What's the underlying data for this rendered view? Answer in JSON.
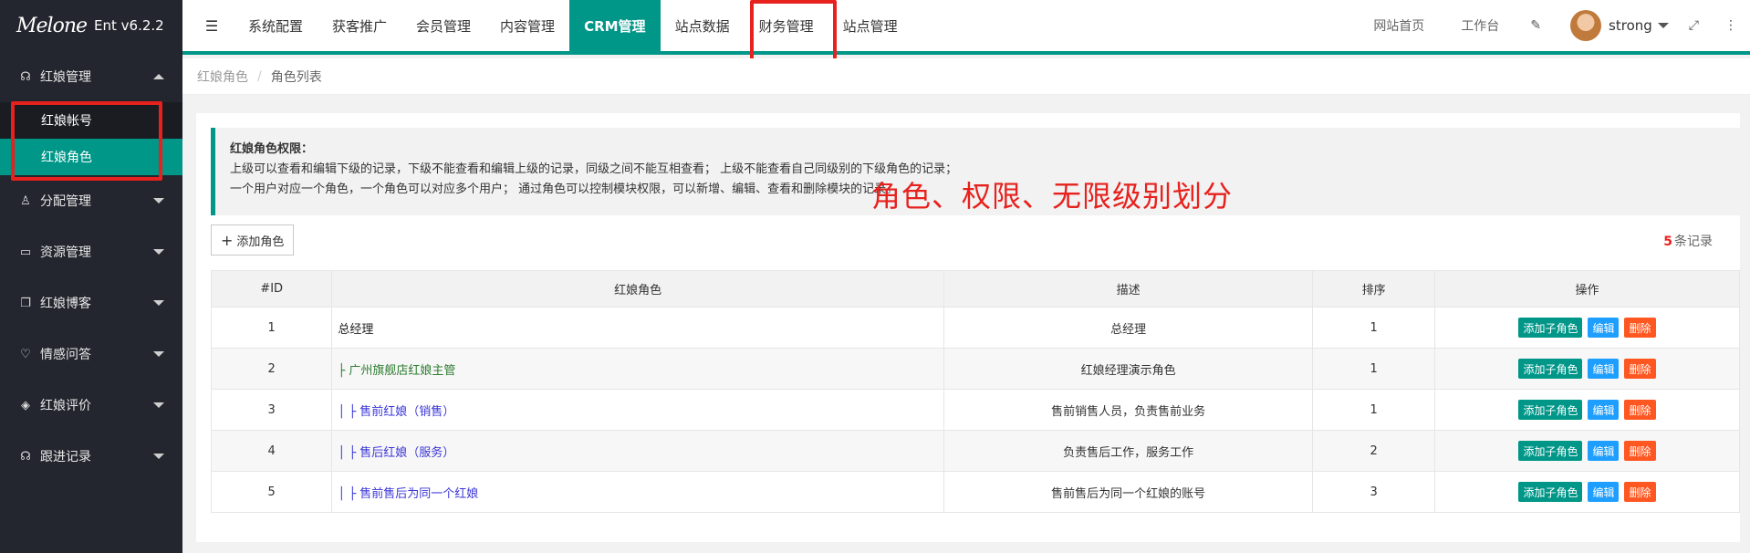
{
  "brand": {
    "logo_text": "Melone",
    "version": "Ent v6.2.2"
  },
  "sidebar": {
    "groups": [
      {
        "label": "红娘管理",
        "icon": "headset-icon",
        "expanded": true,
        "items": [
          {
            "label": "红娘帐号",
            "active": false
          },
          {
            "label": "红娘角色",
            "active": true
          }
        ]
      },
      {
        "label": "分配管理",
        "icon": "user-assign-icon",
        "expanded": false
      },
      {
        "label": "资源管理",
        "icon": "folder-icon",
        "expanded": false
      },
      {
        "label": "红娘博客",
        "icon": "blog-icon",
        "expanded": false
      },
      {
        "label": "情感问答",
        "icon": "heart-pulse-icon",
        "expanded": false
      },
      {
        "label": "红娘评价",
        "icon": "review-icon",
        "expanded": false
      },
      {
        "label": "跟进记录",
        "icon": "headset-icon",
        "expanded": false
      }
    ]
  },
  "header": {
    "tabs": [
      {
        "label": "系统配置",
        "active": false
      },
      {
        "label": "获客推广",
        "active": false
      },
      {
        "label": "会员管理",
        "active": false
      },
      {
        "label": "内容管理",
        "active": false
      },
      {
        "label": "CRM管理",
        "active": true
      },
      {
        "label": "站点数据",
        "active": false
      },
      {
        "label": "财务管理",
        "active": false
      },
      {
        "label": "站点管理",
        "active": false
      }
    ],
    "links": {
      "site_home": "网站首页",
      "workbench": "工作台"
    },
    "user_name": "strong"
  },
  "breadcrumb": {
    "parent": "红娘角色",
    "separator": "/",
    "current": "角色列表"
  },
  "note": {
    "title": "红娘角色权限：",
    "line1": "上级可以查看和编辑下级的记录，下级不能查看和编辑上级的记录，同级之间不能互相查看； 上级不能查看自己同级别的下级角色的记录；",
    "line2": "一个用户对应一个角色，一个角色可以对应多个用户； 通过角色可以控制模块权限，可以新增、编辑、查看和删除模块的记录。"
  },
  "annotation": "角色、权限、无限级别划分",
  "toolbar": {
    "add_label": "添加角色",
    "count": "5",
    "count_suffix": "条记录"
  },
  "table": {
    "headers": [
      "#ID",
      "红娘角色",
      "描述",
      "排序",
      "操作"
    ],
    "rows": [
      {
        "id": "1",
        "role": "总经理",
        "level": 0,
        "desc": "总经理",
        "sort": "1"
      },
      {
        "id": "2",
        "role": "├ 广州旗舰店红娘主管",
        "level": 1,
        "desc": "红娘经理演示角色",
        "sort": "1"
      },
      {
        "id": "3",
        "role": "│  ├ 售前红娘（销售）",
        "level": 2,
        "desc": "售前销售人员，负责售前业务",
        "sort": "1"
      },
      {
        "id": "4",
        "role": "│  ├ 售后红娘（服务）",
        "level": 2,
        "desc": "负责售后工作，服务工作",
        "sort": "2"
      },
      {
        "id": "5",
        "role": "│  ├ 售前售后为同一个红娘",
        "level": 2,
        "desc": "售前售后为同一个红娘的账号",
        "sort": "3"
      }
    ],
    "ops": {
      "add_child": "添加子角色",
      "edit": "编辑",
      "delete": "删除"
    }
  },
  "colors": {
    "accent": "#009688",
    "sidebar_bg": "#23262e",
    "highlight_red": "#e7211d",
    "edit_blue": "#1e9fff",
    "delete_orange": "#ff5722"
  }
}
